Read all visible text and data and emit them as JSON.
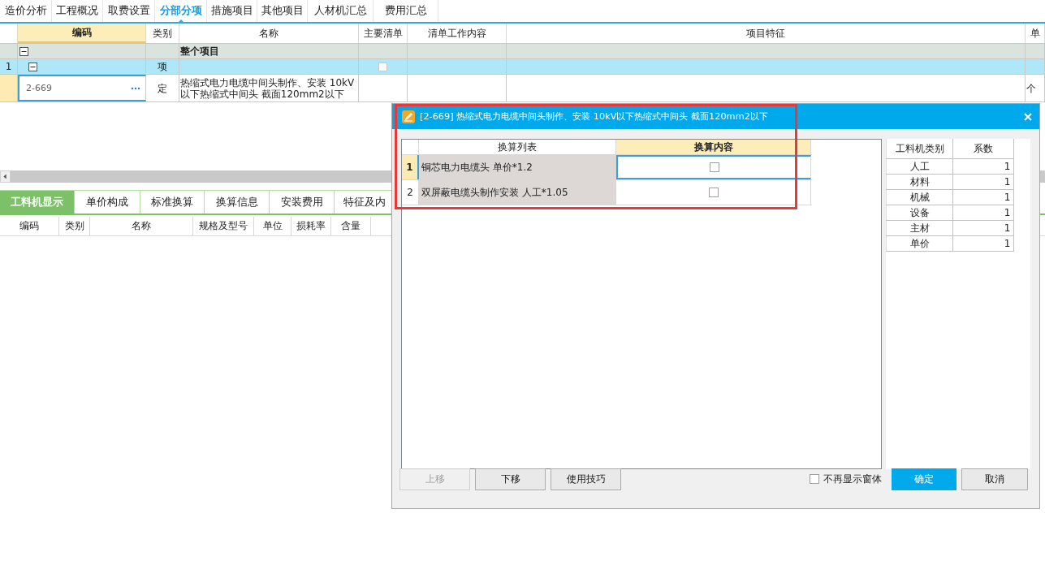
{
  "top_tabs": [
    {
      "label": "造价分析",
      "selected": false
    },
    {
      "label": "工程概况",
      "selected": false
    },
    {
      "label": "取费设置",
      "selected": false
    },
    {
      "label": "分部分项",
      "selected": true
    },
    {
      "label": "措施项目",
      "selected": false
    },
    {
      "label": "其他项目",
      "selected": false
    },
    {
      "label": "人材机汇总",
      "selected": false
    },
    {
      "label": "费用汇总",
      "selected": false
    }
  ],
  "main_grid": {
    "columns": [
      {
        "label": "编码",
        "selected": true
      },
      {
        "label": "类别",
        "selected": false
      },
      {
        "label": "名称",
        "selected": false
      },
      {
        "label": "主要清单",
        "selected": false
      },
      {
        "label": "清单工作内容",
        "selected": false
      },
      {
        "label": "项目特征",
        "selected": false
      },
      {
        "label": "单",
        "selected": false
      }
    ],
    "rows": [
      {
        "kind": "group",
        "number": "",
        "code": "",
        "type": "",
        "name": "整个项目",
        "unit": "",
        "selected": false
      },
      {
        "kind": "section",
        "number": "1",
        "code": "",
        "type": "项",
        "name": "",
        "main_list_checked": false,
        "unit": "",
        "selected": false
      },
      {
        "kind": "item",
        "number": "",
        "code": "2-669",
        "type": "定",
        "name": "热缩式电力电缆中间头制作、安装 10kV以下热缩式中间头 截面120mm2以下",
        "unit": "个",
        "selected": true
      }
    ]
  },
  "bottom_tabs": [
    {
      "label": "工料机显示",
      "selected": true
    },
    {
      "label": "单价构成",
      "selected": false
    },
    {
      "label": "标准换算",
      "selected": false
    },
    {
      "label": "换算信息",
      "selected": false
    },
    {
      "label": "安装费用",
      "selected": false
    },
    {
      "label": "特征及内",
      "selected": false
    }
  ],
  "lower_grid": {
    "columns": [
      "编码",
      "类别",
      "名称",
      "规格及型号",
      "单位",
      "损耗率",
      "含量"
    ]
  },
  "dialog": {
    "title": "[2-669] 热缩式电力电缆中间头制作、安装 10kV以下热缩式中间头 截面120mm2以下",
    "conversion_table": {
      "columns": [
        {
          "label": "换算列表",
          "selected": false
        },
        {
          "label": "换算内容",
          "selected": true
        }
      ],
      "rows": [
        {
          "number": "1",
          "text": "铜芯电力电缆头 单价*1.2",
          "checked": false,
          "selected": true
        },
        {
          "number": "2",
          "text": "双屏蔽电缆头制作安装 人工*1.05",
          "checked": false,
          "selected": false
        }
      ]
    },
    "coefficient_table": {
      "columns": [
        "工料机类别",
        "系数"
      ],
      "rows": [
        {
          "category": "人工",
          "value": "1"
        },
        {
          "category": "材料",
          "value": "1"
        },
        {
          "category": "机械",
          "value": "1"
        },
        {
          "category": "设备",
          "value": "1"
        },
        {
          "category": "主材",
          "value": "1"
        },
        {
          "category": "单价",
          "value": "1"
        }
      ]
    },
    "left_buttons": [
      {
        "label": "上移",
        "disabled": true
      },
      {
        "label": "下移",
        "disabled": false
      },
      {
        "label": "使用技巧",
        "disabled": false
      }
    ],
    "dont_show_again": {
      "label": "不再显示窗体",
      "checked": false
    },
    "right_buttons": [
      {
        "label": "确定",
        "kind": "primary"
      },
      {
        "label": "取消",
        "kind": "normal"
      }
    ]
  }
}
